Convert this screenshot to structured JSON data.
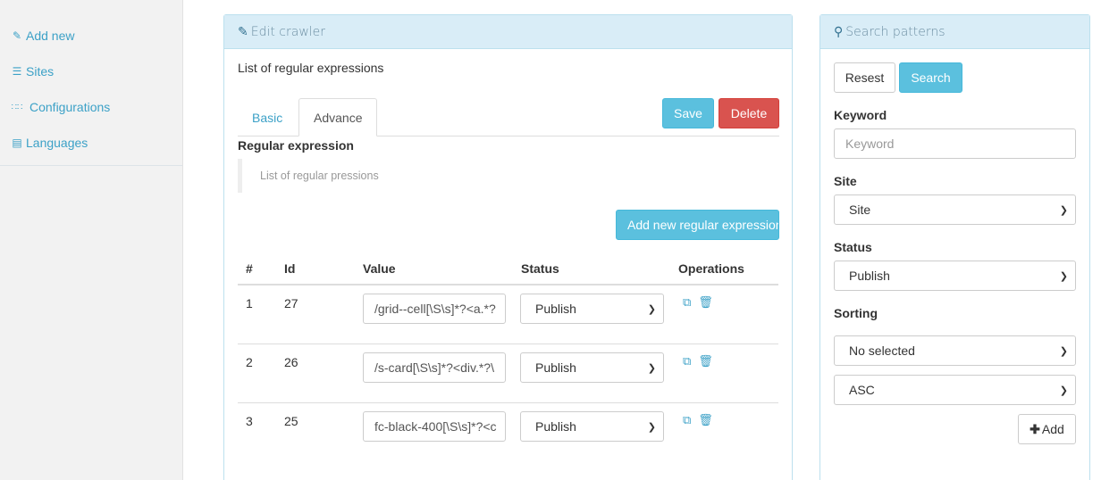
{
  "sidebar": {
    "items": [
      {
        "label": "Add new",
        "icon": "edit-icon"
      },
      {
        "label": "Sites",
        "icon": "list-icon"
      },
      {
        "label": "Configurations",
        "icon": "grid-icon"
      },
      {
        "label": "Languages",
        "icon": "language-icon"
      }
    ]
  },
  "edit": {
    "title": "Edit crawler",
    "subtitle": "List of regular expressions",
    "tabs": [
      "Basic",
      "Advance"
    ],
    "save_label": "Save",
    "delete_label": "Delete",
    "section_label": "Regular expression",
    "blockquote": "List of regular pressions",
    "add_label": "Add new regular expression",
    "table": {
      "headers": [
        "#",
        "Id",
        "Value",
        "Status",
        "Operations"
      ],
      "rows": [
        {
          "num": "1",
          "id": "27",
          "value": "/grid--cell[\\S\\s]*?<a.*?",
          "status": "Publish"
        },
        {
          "num": "2",
          "id": "26",
          "value": "/s-card[\\S\\s]*?<div.*?\\",
          "status": "Publish"
        },
        {
          "num": "3",
          "id": "25",
          "value": "fc-black-400[\\S\\s]*?<c",
          "status": "Publish"
        }
      ]
    }
  },
  "search": {
    "title": "Search patterns",
    "reset_label": "Resest",
    "search_label": "Search",
    "keyword_label": "Keyword",
    "keyword_placeholder": "Keyword",
    "site_label": "Site",
    "site_value": "Site",
    "status_label": "Status",
    "status_value": "Publish",
    "sorting_label": "Sorting",
    "sort_field_value": "No selected",
    "sort_order_value": "ASC",
    "add_label": "Add"
  },
  "colors": {
    "accent": "#3ca1c7",
    "info": "#5bc0de",
    "danger": "#d9534f",
    "panel_heading": "#d9edf7"
  }
}
